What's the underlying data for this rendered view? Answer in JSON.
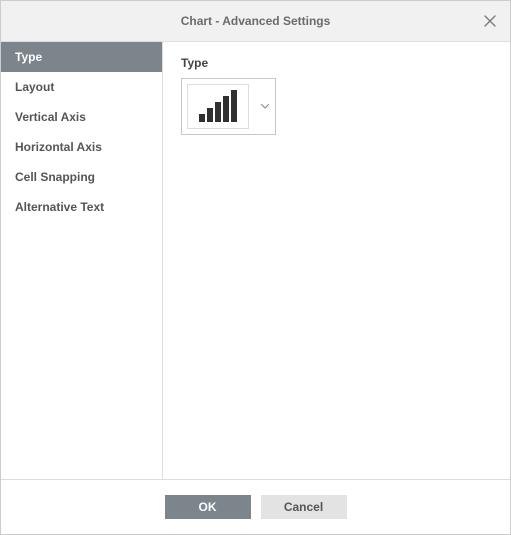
{
  "dialog": {
    "title": "Chart - Advanced Settings"
  },
  "sidebar": {
    "items": [
      {
        "label": "Type",
        "active": true
      },
      {
        "label": "Layout",
        "active": false
      },
      {
        "label": "Vertical Axis",
        "active": false
      },
      {
        "label": "Horizontal Axis",
        "active": false
      },
      {
        "label": "Cell Snapping",
        "active": false
      },
      {
        "label": "Alternative Text",
        "active": false
      }
    ]
  },
  "content": {
    "type_label": "Type",
    "selected_type": "bar",
    "selected_type_name": "Bar chart"
  },
  "footer": {
    "ok_label": "OK",
    "cancel_label": "Cancel"
  }
}
